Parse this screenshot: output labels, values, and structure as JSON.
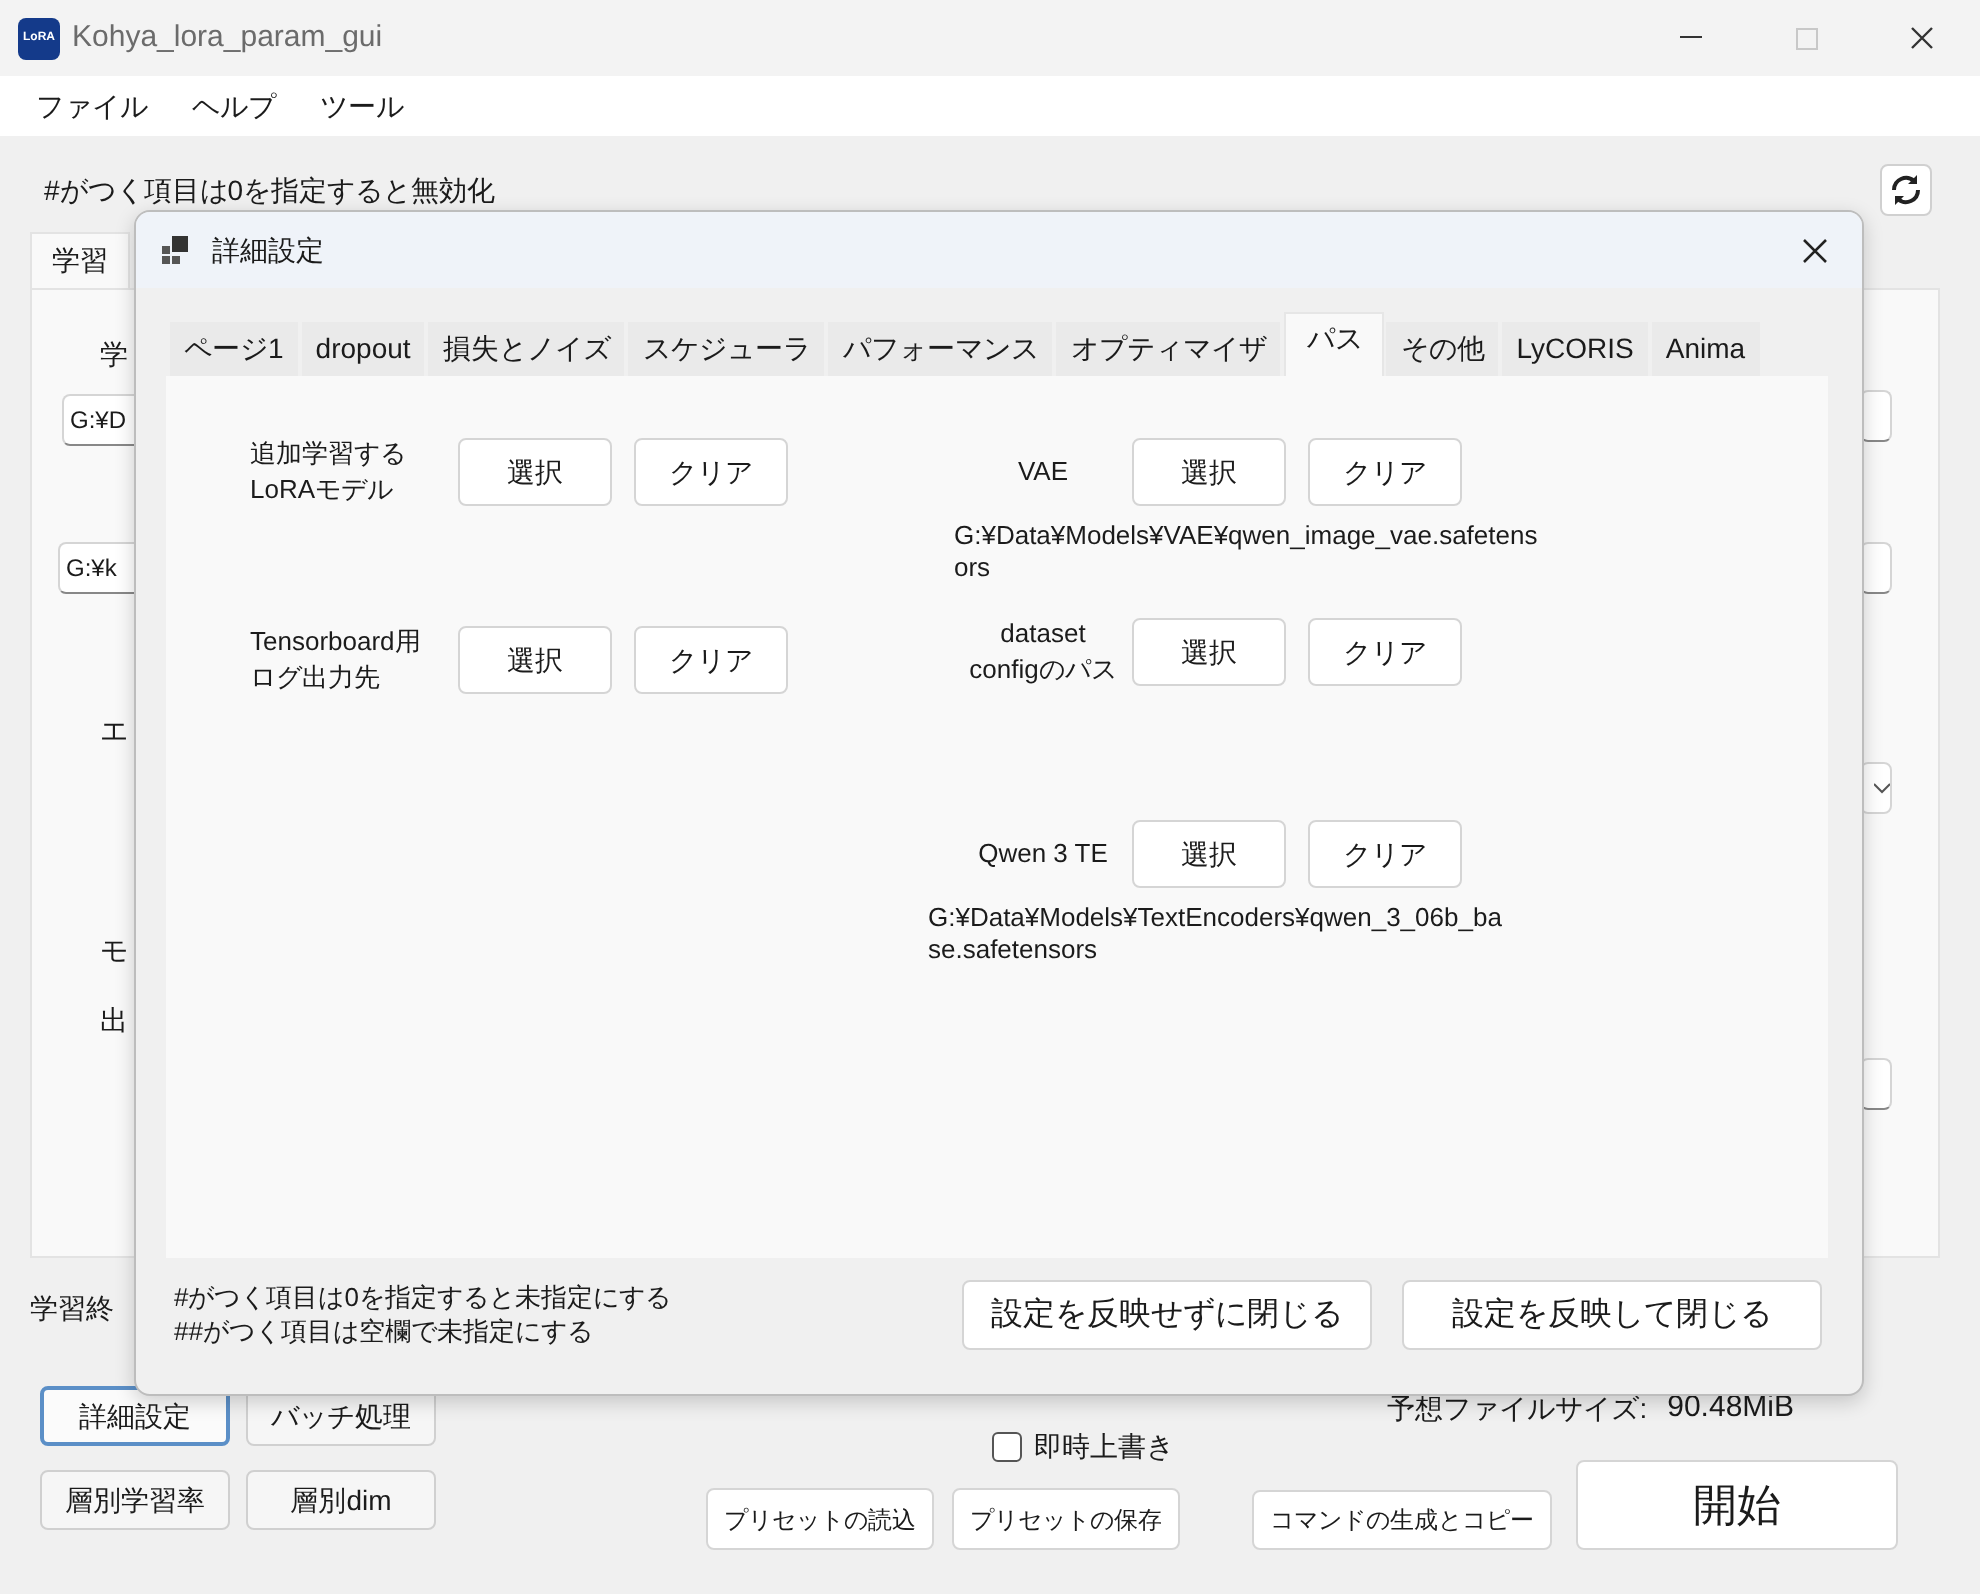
{
  "window": {
    "title": "Kohya_lora_param_gui",
    "icon_text": "LoRA"
  },
  "menu": [
    "ファイル",
    "ヘルプ",
    "ツール"
  ],
  "main": {
    "note": "#がつく項目は0を指定すると無効化",
    "tabs": [
      {
        "label": "学習",
        "selected": true
      }
    ],
    "hidden_items": [
      {
        "kind": "label",
        "text": "学"
      },
      {
        "kind": "field",
        "text": "G:¥D"
      },
      {
        "kind": "field",
        "text": "G:¥k"
      },
      {
        "kind": "label",
        "text": "エ"
      },
      {
        "kind": "label",
        "text": "モ"
      },
      {
        "kind": "label",
        "text": "出"
      }
    ],
    "end_label": "学習終",
    "left_buttons": [
      {
        "label": "詳細設定",
        "focused": true
      },
      {
        "label": "バッチ処理",
        "focused": false
      },
      {
        "label": "層別学習率",
        "focused": false
      },
      {
        "label": "層別dim",
        "focused": false
      }
    ],
    "overwrite": {
      "label": "即時上書き",
      "checked": false
    },
    "file_size": {
      "label": "予想ファイルサイズ:",
      "value": "90.48MiB"
    },
    "preset_buttons": [
      "プリセットの読込",
      "プリセットの保存"
    ],
    "command_button": "コマンドの生成とコピー",
    "start_button": "開始"
  },
  "dialog": {
    "title": "詳細設定",
    "tabs": [
      {
        "label": "ページ1",
        "selected": false
      },
      {
        "label": "dropout",
        "selected": false
      },
      {
        "label": "損失とノイズ",
        "selected": false
      },
      {
        "label": "スケジューラ",
        "selected": false
      },
      {
        "label": "パフォーマンス",
        "selected": false
      },
      {
        "label": "オプティマイザ",
        "selected": false
      },
      {
        "label": "パス",
        "selected": true
      },
      {
        "label": "その他",
        "selected": false
      },
      {
        "label": "LyCORIS",
        "selected": false
      },
      {
        "label": "Anima",
        "selected": false
      }
    ],
    "left_rows": [
      {
        "label": [
          "追加学習する",
          "LoRAモデル"
        ],
        "select": "選択",
        "clear": "クリア"
      },
      {
        "label": [
          "Tensorboard用",
          "ログ出力先"
        ],
        "select": "選択",
        "clear": "クリア"
      }
    ],
    "right_rows": [
      {
        "label": [
          "VAE"
        ],
        "select": "選択",
        "clear": "クリア",
        "path": "G:¥Data¥Models¥VAE¥qwen_image_vae.safetensors"
      },
      {
        "label": [
          "dataset",
          "configのパス"
        ],
        "select": "選択",
        "clear": "クリア"
      },
      {
        "label": [
          "Qwen 3 TE"
        ],
        "select": "選択",
        "clear": "クリア",
        "path": "G:¥Data¥Models¥TextEncoders¥qwen_3_06b_base.safetensors"
      }
    ],
    "notes": [
      "#がつく項目は0を指定すると未指定にする",
      "##がつく項目は空欄で未指定にする"
    ],
    "buttons": [
      "設定を反映せずに閉じる",
      "設定を反映して閉じる"
    ]
  }
}
